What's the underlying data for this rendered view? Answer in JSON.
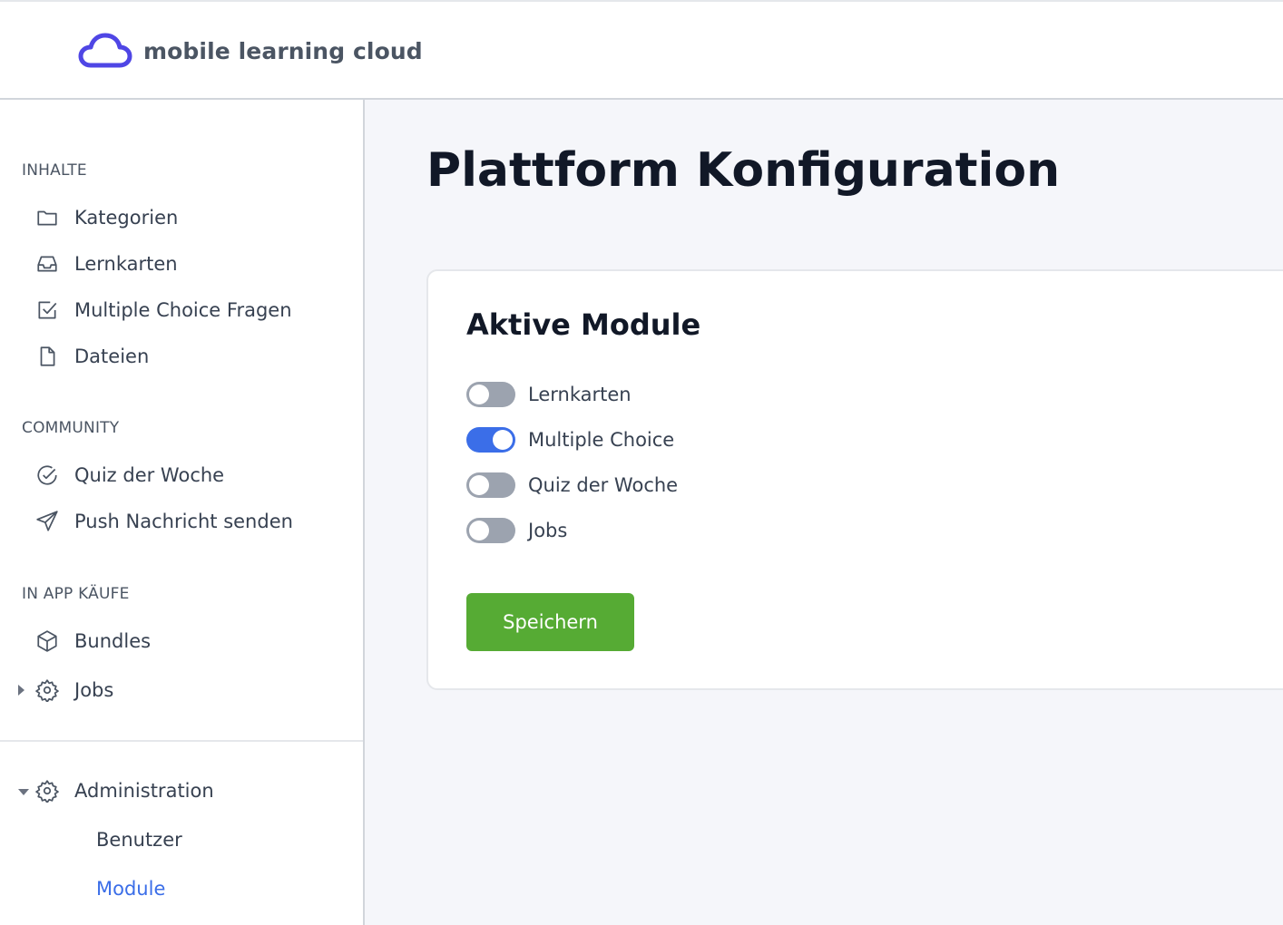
{
  "brand": {
    "name": "mobile learning cloud",
    "color": "#4f46e5"
  },
  "sidebar": {
    "sections": [
      {
        "title": "INHALTE",
        "items": [
          {
            "label": "Kategorien",
            "icon": "folder-icon"
          },
          {
            "label": "Lernkarten",
            "icon": "inbox-icon"
          },
          {
            "label": "Multiple Choice Fragen",
            "icon": "checkbox-icon"
          },
          {
            "label": "Dateien",
            "icon": "file-icon"
          }
        ]
      },
      {
        "title": "COMMUNITY",
        "items": [
          {
            "label": "Quiz der Woche",
            "icon": "check-circle-icon"
          },
          {
            "label": "Push Nachricht senden",
            "icon": "send-icon"
          }
        ]
      },
      {
        "title": "IN APP KÄUFE",
        "items": [
          {
            "label": "Bundles",
            "icon": "cube-icon"
          },
          {
            "label": "Jobs",
            "icon": "gear-icon",
            "expanded": false
          }
        ]
      }
    ],
    "administration": {
      "label": "Administration",
      "icon": "gear-icon",
      "expanded": true,
      "children": [
        {
          "label": "Benutzer",
          "active": false
        },
        {
          "label": "Module",
          "active": true
        }
      ]
    }
  },
  "main": {
    "title": "Plattform Konfiguration",
    "card": {
      "title": "Aktive Module",
      "toggles": [
        {
          "label": "Lernkarten",
          "on": false
        },
        {
          "label": "Multiple Choice",
          "on": true
        },
        {
          "label": "Quiz der Woche",
          "on": false
        },
        {
          "label": "Jobs",
          "on": false
        }
      ],
      "save_label": "Speichern"
    }
  },
  "colors": {
    "accent": "#3b6ee8",
    "save": "#56ab34",
    "toggle_off": "#9ca3af"
  }
}
